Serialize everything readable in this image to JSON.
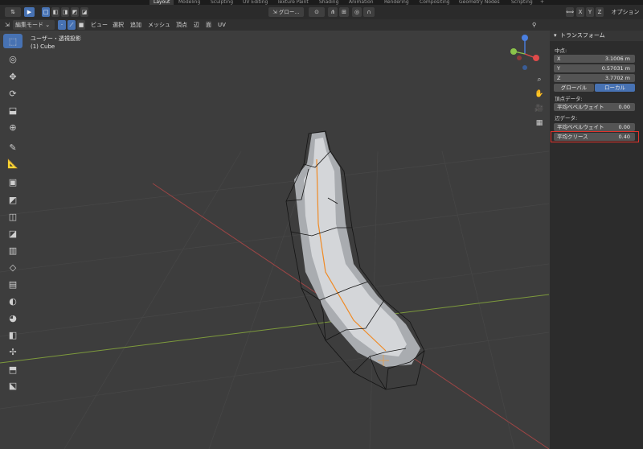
{
  "workspaces": [
    "Layout",
    "Modeling",
    "Sculpting",
    "UV Editing",
    "Texture Paint",
    "Shading",
    "Animation",
    "Rendering",
    "Compositing",
    "Geometry Nodes",
    "Scripting"
  ],
  "header": {
    "mode": "編集モード",
    "menus": [
      "ビュー",
      "選択",
      "追加",
      "メッシュ",
      "頂点",
      "辺",
      "面",
      "UV"
    ],
    "transform_orientation": "グロー...",
    "axes": [
      "X",
      "Y",
      "Z"
    ],
    "options": "オプション"
  },
  "viewport": {
    "view_name": "ユーザー・透視投影",
    "object_name": "(1) Cube"
  },
  "panel": {
    "title": "トランスフォーム",
    "median_label": "中点:",
    "x_label": "X",
    "x_value": "3.1006 m",
    "y_label": "Y",
    "y_value": "0.57031 m",
    "z_label": "Z",
    "z_value": "3.7702 m",
    "global": "グローバル",
    "local": "ローカル",
    "vertex_data": "頂点データ:",
    "vertex_bevel_label": "平均ベベルウェイト",
    "vertex_bevel_value": "0.00",
    "edge_data": "辺データ:",
    "edge_bevel_label": "平均ベベルウェイト",
    "edge_bevel_value": "0.00",
    "crease_label": "平均クリース",
    "crease_value": "0.40"
  },
  "colors": {
    "accent": "#4772b3",
    "highlight": "#e0332c",
    "axis_x": "#e04a4a",
    "axis_y": "#8bc34a",
    "axis_z": "#4a7fe0",
    "edge_selected": "#f08a24"
  }
}
